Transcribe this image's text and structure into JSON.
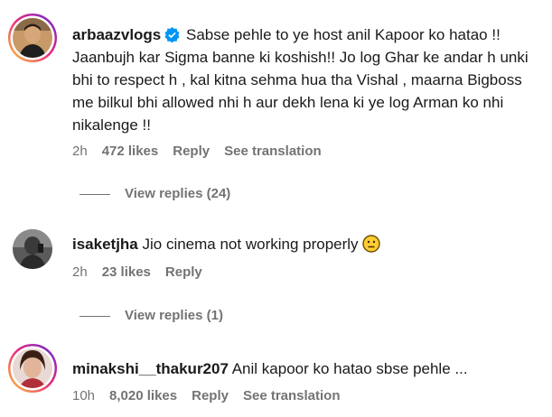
{
  "comments": [
    {
      "username": "arbaazvlogs",
      "verified": true,
      "text": "Sabse pehle to ye host anil Kapoor ko hatao !! Jaanbujh kar Sigma banne ki koshish!! Jo log Ghar ke andar h unki bhi to respect h , kal kitna sehma hua tha Vishal , maarna Bigboss me bilkul bhi allowed nhi h aur dekh lena ki ye log Arman ko nhi nikalenge !!",
      "time": "2h",
      "likes": "472 likes",
      "reply_label": "Reply",
      "translation_label": "See translation",
      "view_replies": "View replies (24)"
    },
    {
      "username": "isaketjha",
      "verified": false,
      "text": "Jio cinema not working properly",
      "emoji": "neutral-face-emoji",
      "time": "2h",
      "likes": "23 likes",
      "reply_label": "Reply",
      "view_replies": "View replies (1)"
    },
    {
      "username": "minakshi__thakur207",
      "verified": false,
      "text": "Anil kapoor ko hatao sbse pehle ...",
      "time": "10h",
      "likes": "8,020 likes",
      "reply_label": "Reply",
      "translation_label": "See translation"
    }
  ],
  "colors": {
    "story_ring_start": "#f9ce34",
    "story_ring_mid": "#ee2a7b",
    "story_ring_end": "#6228d7",
    "verified_badge": "#0095f6",
    "meta_text": "#737373"
  }
}
